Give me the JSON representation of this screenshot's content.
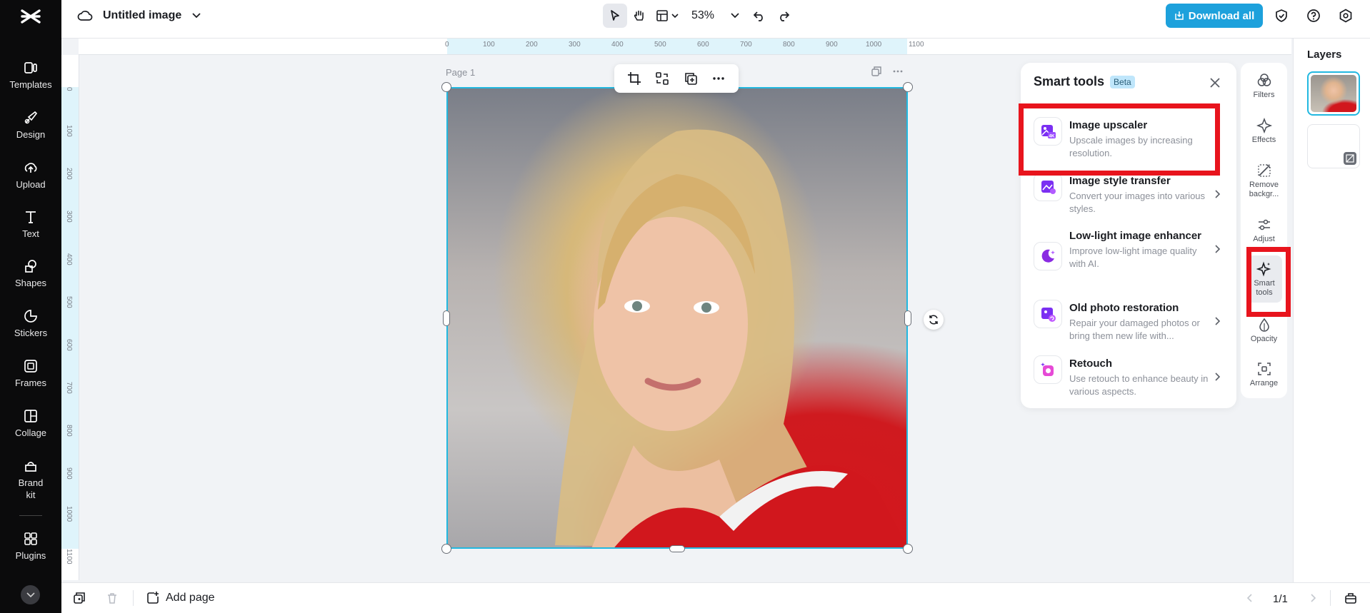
{
  "app": {
    "title": "Untitled image",
    "zoom": "53%",
    "download_label": "Download all"
  },
  "sidebar": {
    "items": [
      {
        "label": "Templates",
        "icon": "templates-icon"
      },
      {
        "label": "Design",
        "icon": "design-icon"
      },
      {
        "label": "Upload",
        "icon": "upload-icon"
      },
      {
        "label": "Text",
        "icon": "text-icon"
      },
      {
        "label": "Shapes",
        "icon": "shapes-icon"
      },
      {
        "label": "Stickers",
        "icon": "stickers-icon"
      },
      {
        "label": "Frames",
        "icon": "frames-icon"
      },
      {
        "label": "Collage",
        "icon": "collage-icon"
      },
      {
        "label": "Brand kit",
        "icon": "brand-kit-icon"
      },
      {
        "label": "Plugins",
        "icon": "plugins-icon"
      }
    ]
  },
  "ruler": {
    "h": [
      "0",
      "100",
      "200",
      "300",
      "400",
      "500",
      "600",
      "700",
      "800",
      "900",
      "1000",
      "1100"
    ],
    "v": [
      "0",
      "100",
      "200",
      "300",
      "400",
      "500",
      "600",
      "700",
      "800",
      "900",
      "1000",
      "1100"
    ]
  },
  "canvas": {
    "page_label": "Page 1"
  },
  "smart_tools": {
    "title": "Smart tools",
    "badge": "Beta",
    "items": [
      {
        "name": "Image upscaler",
        "desc": "Upscale images by increasing resolution."
      },
      {
        "name": "Image style transfer",
        "desc": "Convert your images into various styles."
      },
      {
        "name": "Low-light image enhancer",
        "desc": "Improve low-light image quality with AI."
      },
      {
        "name": "Old photo restoration",
        "desc": "Repair your damaged photos or bring them new life with..."
      },
      {
        "name": "Retouch",
        "desc": "Use retouch to enhance beauty in various aspects."
      }
    ]
  },
  "properties": {
    "items": [
      {
        "label": "Filters"
      },
      {
        "label": "Effects"
      },
      {
        "label": "Remove backgr..."
      },
      {
        "label": "Adjust"
      },
      {
        "label": "Smart tools"
      },
      {
        "label": "Opacity"
      },
      {
        "label": "Arrange"
      }
    ]
  },
  "layers": {
    "title": "Layers"
  },
  "bottom": {
    "add_page": "Add page",
    "page_count": "1/1"
  },
  "colors": {
    "accent": "#1da1dc",
    "selection": "#22b8e0",
    "highlight": "#e8141d"
  }
}
